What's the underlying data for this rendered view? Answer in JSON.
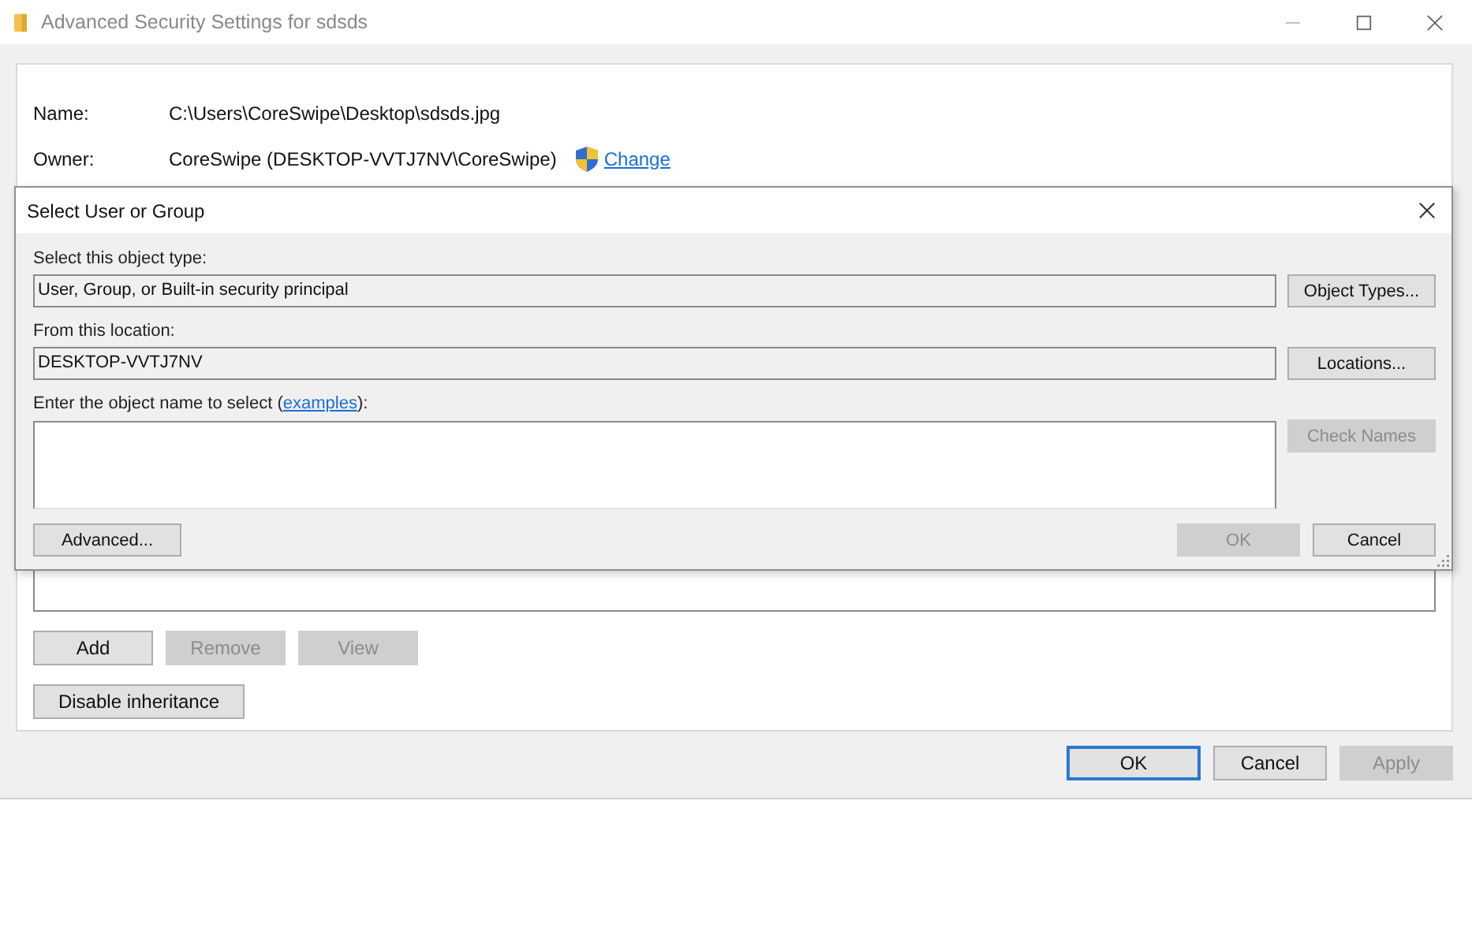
{
  "window": {
    "title": "Advanced Security Settings for sdsds"
  },
  "properties": [
    {
      "label": "Name:",
      "value": "C:\\Users\\CoreSwipe\\Desktop\\sdsds.jpg"
    },
    {
      "label": "Owner:",
      "value": "CoreSwipe (DESKTOP-VVTJ7NV\\CoreSwipe)",
      "link": "Change"
    }
  ],
  "entry_buttons": [
    {
      "label": "Add",
      "disabled": false
    },
    {
      "label": "Remove",
      "disabled": true
    },
    {
      "label": "View",
      "disabled": true
    }
  ],
  "inheritance_button": {
    "label": "Disable inheritance",
    "disabled": false
  },
  "footer_buttons": [
    {
      "label": "OK",
      "disabled": false,
      "focused": true
    },
    {
      "label": "Cancel",
      "disabled": false,
      "focused": false
    },
    {
      "label": "Apply",
      "disabled": true,
      "focused": false
    }
  ],
  "dialog": {
    "title": "Select User or Group",
    "fields": [
      {
        "label": "Select this object type:",
        "value": "User, Group, or Built-in security principal",
        "button": {
          "label": "Object Types...",
          "disabled": false
        }
      },
      {
        "label": "From this location:",
        "value": "DESKTOP-VVTJ7NV",
        "button": {
          "label": "Locations...",
          "disabled": false
        }
      }
    ],
    "object_name": {
      "label_before": "Enter the object name to select (",
      "link": "examples",
      "label_after": "):",
      "button": {
        "label": "Check Names",
        "disabled": true
      }
    },
    "advanced_button": {
      "label": "Advanced...",
      "disabled": false
    },
    "buttons": [
      {
        "label": "OK",
        "disabled": true
      },
      {
        "label": "Cancel",
        "disabled": false
      }
    ]
  }
}
